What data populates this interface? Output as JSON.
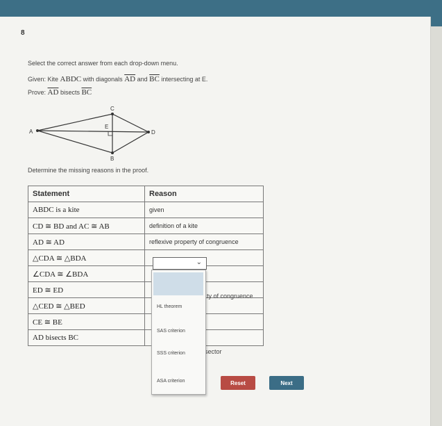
{
  "header": {
    "question_number": "8"
  },
  "instructions": "Select the correct answer from each drop-down menu.",
  "given": {
    "prefix": "Given: Kite",
    "kite": "ABDC",
    "mid1": "with diagonals",
    "seg1": "AD",
    "mid2": "and",
    "seg2": "BC",
    "suffix": "intersecting at E."
  },
  "prove": {
    "prefix": "Prove:",
    "seg1": "AD",
    "mid": "bisects",
    "seg2": "BC"
  },
  "diagram_labels": {
    "A": "A",
    "B": "B",
    "C": "C",
    "D": "D",
    "E": "E"
  },
  "determine": "Determine the missing reasons in the proof.",
  "table": {
    "header_statement": "Statement",
    "header_reason": "Reason",
    "rows": [
      {
        "statement": "ABDC is a kite",
        "reason": "given"
      },
      {
        "statement": "CD ≅ BD and AC ≅ AB",
        "reason": "definition of a kite"
      },
      {
        "statement": "AD ≅ AD",
        "reason": "reflexive property of congruence"
      },
      {
        "statement": "△CDA ≅ △BDA",
        "reason": ""
      },
      {
        "statement": "∠CDA ≅ ∠BDA",
        "reason": ""
      },
      {
        "statement": "ED ≅ ED",
        "reason": ""
      },
      {
        "statement": "△CED ≅ △BED",
        "reason": ""
      },
      {
        "statement": "CE ≅ BE",
        "reason": ""
      },
      {
        "statement": "AD bisects BC",
        "reason": ""
      }
    ]
  },
  "dropdown": {
    "options": [
      "HL theorem",
      "SAS criterion",
      "SSS criterion",
      "ASA criterion"
    ]
  },
  "peek_text": {
    "row6": "ty of congruence",
    "row9": "sector"
  },
  "buttons": {
    "reset": "Reset",
    "next": "Next"
  },
  "colors": {
    "topbar": "#3d6f86",
    "reset": "#b84b44",
    "next": "#3b6d86",
    "highlight": "#cfdde8"
  }
}
